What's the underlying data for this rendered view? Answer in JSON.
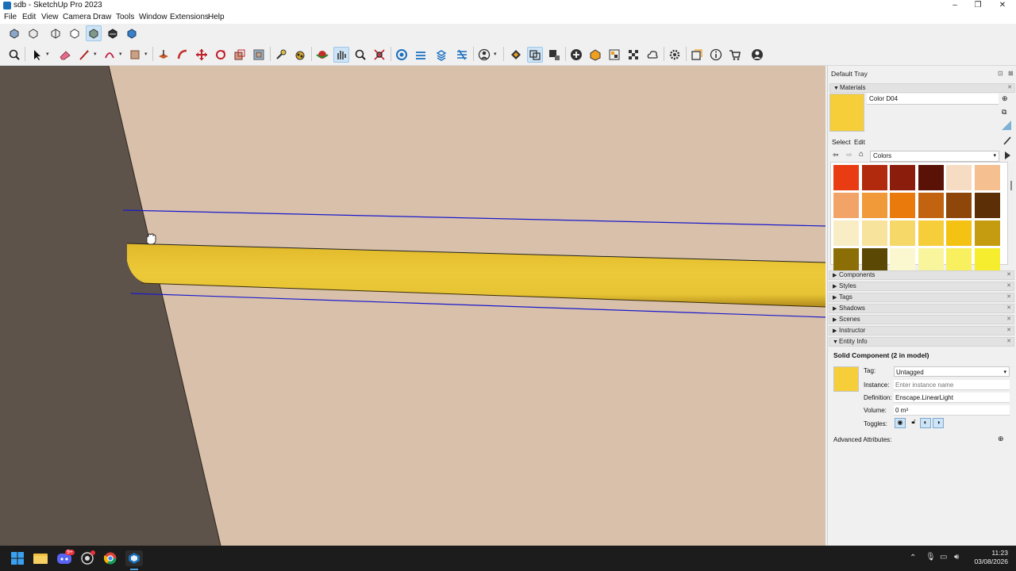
{
  "window": {
    "title": "sdb - SketchUp Pro 2023",
    "minimize": "–",
    "maximize": "❐",
    "close": "✕"
  },
  "menu": [
    "File",
    "Edit",
    "View",
    "Camera",
    "Draw",
    "Tools",
    "Window",
    "Extensions",
    "Help"
  ],
  "toolbar1": [
    "xray-style-icon",
    "back-edges-style-icon",
    "wireframe-style-icon",
    "hidden-line-style-icon",
    "shaded-style-icon",
    "textured-style-icon",
    "monochrome-style-icon"
  ],
  "toolbar2": [
    "search-icon",
    "select-icon",
    "eraser-icon",
    "line-icon",
    "arc-icon",
    "rectangle-icon",
    "push-pull-icon",
    "follow-me-icon",
    "move-icon",
    "rotate-icon",
    "scale-icon",
    "offset-icon",
    "tape-measure-icon",
    "paint-bucket-icon",
    "orbit-icon",
    "pan-icon",
    "zoom-icon",
    "zoom-extents-icon",
    "warehouse-icon",
    "extension-warehouse-icon",
    "layout-icon",
    "style-builder-icon",
    "account-icon",
    "enscape-start-icon",
    "enscape-sync-icon",
    "enscape-views-icon",
    "add-icon",
    "asset-library-icon",
    "material-editor-icon",
    "checker-icon",
    "upload-icon",
    "settings-icon",
    "feedback-icon",
    "info-icon",
    "cart-icon",
    "profile-icon"
  ],
  "tray": {
    "title": "Default Tray",
    "materials_title": "Materials",
    "material_name": "Color D04",
    "material_color": "#f5ce3a",
    "tab_select": "Select",
    "tab_edit": "Edit",
    "library": "Colors",
    "swatches": [
      "#e93c12",
      "#b22a0e",
      "#8a1d0c",
      "#5a1206",
      "#f7dcc4",
      "#f5bf90",
      "#f2a468",
      "#f09a3a",
      "#eb7a0c",
      "#c2630f",
      "#8e4708",
      "#5c2f06",
      "#f8edc4",
      "#f7e39c",
      "#f5d868",
      "#f5ce3a",
      "#f3c212",
      "#c59b10",
      "#8c6e06",
      "#5b4804",
      "#fbf8d0",
      "#f9f59c",
      "#f8f05e",
      "#f5ed2e"
    ],
    "sections": [
      "Components",
      "Styles",
      "Tags",
      "Shadows",
      "Scenes",
      "Instructor",
      "Entity Info"
    ],
    "entity": {
      "heading": "Solid Component (2 in model)",
      "tag_label": "Tag:",
      "tag_value": "Untagged",
      "instance_label": "Instance:",
      "instance_placeholder": "Enter instance name",
      "definition_label": "Definition:",
      "definition_value": "Enscape.LinearLight",
      "volume_label": "Volume:",
      "volume_value": "0 m³",
      "toggles_label": "Toggles:",
      "advanced_label": "Advanced Attributes:"
    }
  },
  "taskbar": {
    "apps": [
      "windows-start-icon",
      "file-explorer-icon",
      "discord-icon",
      "github-icon",
      "chrome-icon",
      "sketchup-icon"
    ],
    "discord_badge": "9+",
    "time": "11:23",
    "date": "03/08/2026"
  },
  "colors": {
    "viewport_bg": "#d8c0aa",
    "wall": "#5e534a",
    "edge_blue": "#1a1acc",
    "light_yellow": "#e8c633"
  }
}
